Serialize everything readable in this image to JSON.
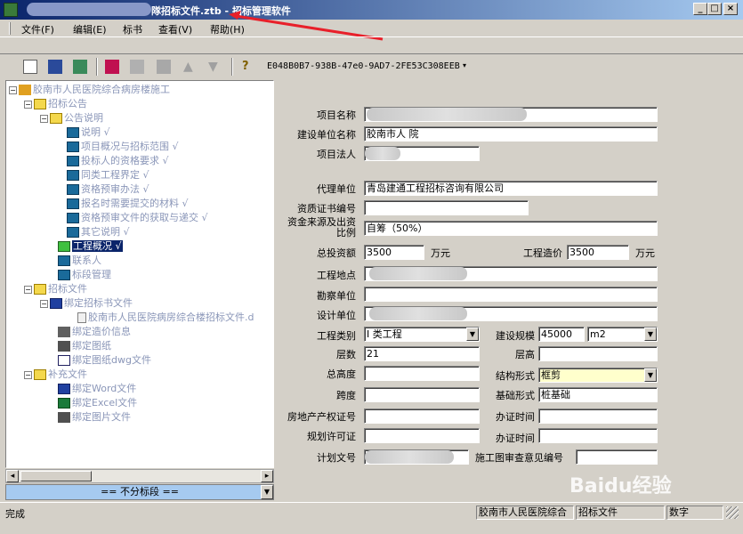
{
  "titlebar": {
    "title": "隊招标文件.ztb - 招标管理软件",
    "min": "_",
    "max": "□",
    "close": "×"
  },
  "menu": [
    {
      "label": "文件(F)"
    },
    {
      "label": "编辑(E)"
    },
    {
      "label": "标书"
    },
    {
      "label": "查看(V)"
    },
    {
      "label": "帮助(H)"
    }
  ],
  "toolbar": {
    "guid": "E048B0B7-938B-47e0-9AD7-2FE53C308EEB"
  },
  "tree": [
    {
      "label": "胶南市人民医院综合病房楼施工"
    },
    {
      "label": "招标公告"
    },
    {
      "label": "公告说明"
    },
    {
      "label": "说明 √"
    },
    {
      "label": "项目概况与招标范围 √"
    },
    {
      "label": "投标人的资格要求 √"
    },
    {
      "label": "同类工程界定 √"
    },
    {
      "label": "资格预审办法 √"
    },
    {
      "label": "报名时需要提交的材料 √"
    },
    {
      "label": "资格预审文件的获取与递交 √"
    },
    {
      "label": "其它说明 √"
    },
    {
      "label": "工程概况 √"
    },
    {
      "label": "联系人"
    },
    {
      "label": "标段管理"
    },
    {
      "label": "招标文件"
    },
    {
      "label": "绑定招标书文件"
    },
    {
      "label": "胶南市人民医院病房综合楼招标文件.d"
    },
    {
      "label": "绑定造价信息"
    },
    {
      "label": "绑定图纸"
    },
    {
      "label": "绑定图纸dwg文件"
    },
    {
      "label": "补充文件"
    },
    {
      "label": "绑定Word文件"
    },
    {
      "label": "绑定Excel文件"
    },
    {
      "label": "绑定图片文件"
    }
  ],
  "stage_selector": "== 不分标段 ==",
  "form": {
    "project_name_label": "项目名称",
    "builder_label": "建设单位名称",
    "builder_value": "胶南市人  院",
    "legal_label": "项目法人",
    "agent_label": "代理单位",
    "agent_value": "青岛建通工程招标咨询有限公司",
    "cert_label": "资质证书编号",
    "fund_label": "资金来源及出资比例",
    "fund_value": "自筹（50%）",
    "invest_label": "总投资额",
    "invest_value": "3500",
    "invest_unit": "万元",
    "cost_label": "工程造价",
    "cost_value": "3500",
    "cost_unit": "万元",
    "location_label": "工程地点",
    "survey_label": "勘察单位",
    "design_label": "设计单位",
    "category_label": "工程类别",
    "category_value": "I 类工程",
    "scale_label": "建设规模",
    "scale_value": "45000",
    "scale_unit": "m2",
    "floors_label": "层数",
    "floors_value": "21",
    "floor_height_label": "层高",
    "total_height_label": "总高度",
    "structure_label": "结构形式",
    "structure_value": "框剪",
    "span_label": "跨度",
    "foundation_label": "基础形式",
    "foundation_value": "桩基础",
    "property_label": "房地产产权证号",
    "cert_time_label": "办证时间",
    "planning_label": "规划许可证",
    "cert_time2_label": "办证时间",
    "plan_doc_label": "计划文号",
    "review_label": "施工图审查意见编号"
  },
  "statusbar": {
    "ready": "完成",
    "pane1": "胶南市人民医院综合",
    "pane2": "招标文件",
    "pane3": "数字"
  },
  "watermark": "Baidu经验"
}
